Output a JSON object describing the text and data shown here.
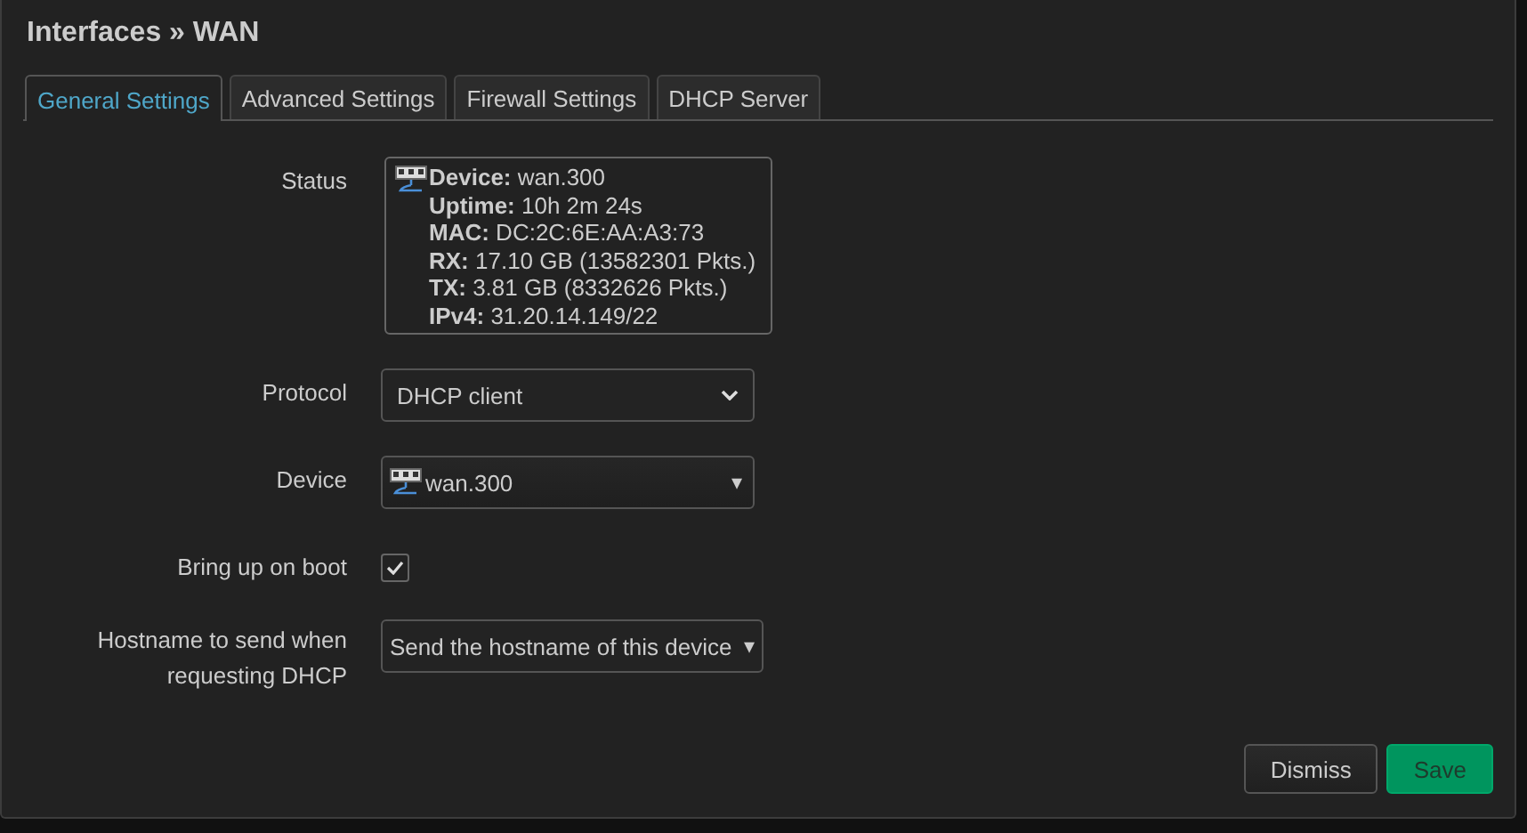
{
  "dialog": {
    "title": "Interfaces » WAN"
  },
  "tabs": [
    {
      "label": "General Settings",
      "selected": true
    },
    {
      "label": "Advanced Settings",
      "selected": false
    },
    {
      "label": "Firewall Settings",
      "selected": false
    },
    {
      "label": "DHCP Server",
      "selected": false
    }
  ],
  "fields": [
    {
      "kind": "status",
      "label": "Status",
      "lines": [
        {
          "label": "Device:",
          "value": "wan.300"
        },
        {
          "label": "Uptime:",
          "value": "10h 2m 24s"
        },
        {
          "label": "MAC:",
          "value": "DC:2C:6E:AA:A3:73"
        },
        {
          "label": "RX:",
          "value": "17.10 GB (13582301 Pkts.)"
        },
        {
          "label": "TX:",
          "value": "3.81 GB (8332626 Pkts.)"
        },
        {
          "label": "IPv4:",
          "value": "31.20.14.149/22"
        }
      ]
    },
    {
      "kind": "select",
      "label": "Protocol",
      "value": "DHCP client"
    },
    {
      "kind": "device",
      "label": "Device",
      "value": "wan.300",
      "caret": "▾"
    },
    {
      "kind": "checkbox",
      "label": "Bring up on boot",
      "checked": true
    },
    {
      "kind": "dropdown",
      "label": "Hostname to send when requesting DHCP",
      "value": "Send the hostname of this device",
      "caret": "▾"
    }
  ],
  "buttons": [
    {
      "label": "Dismiss",
      "kind": "neutral"
    },
    {
      "label": "Save",
      "kind": "primary"
    }
  ]
}
